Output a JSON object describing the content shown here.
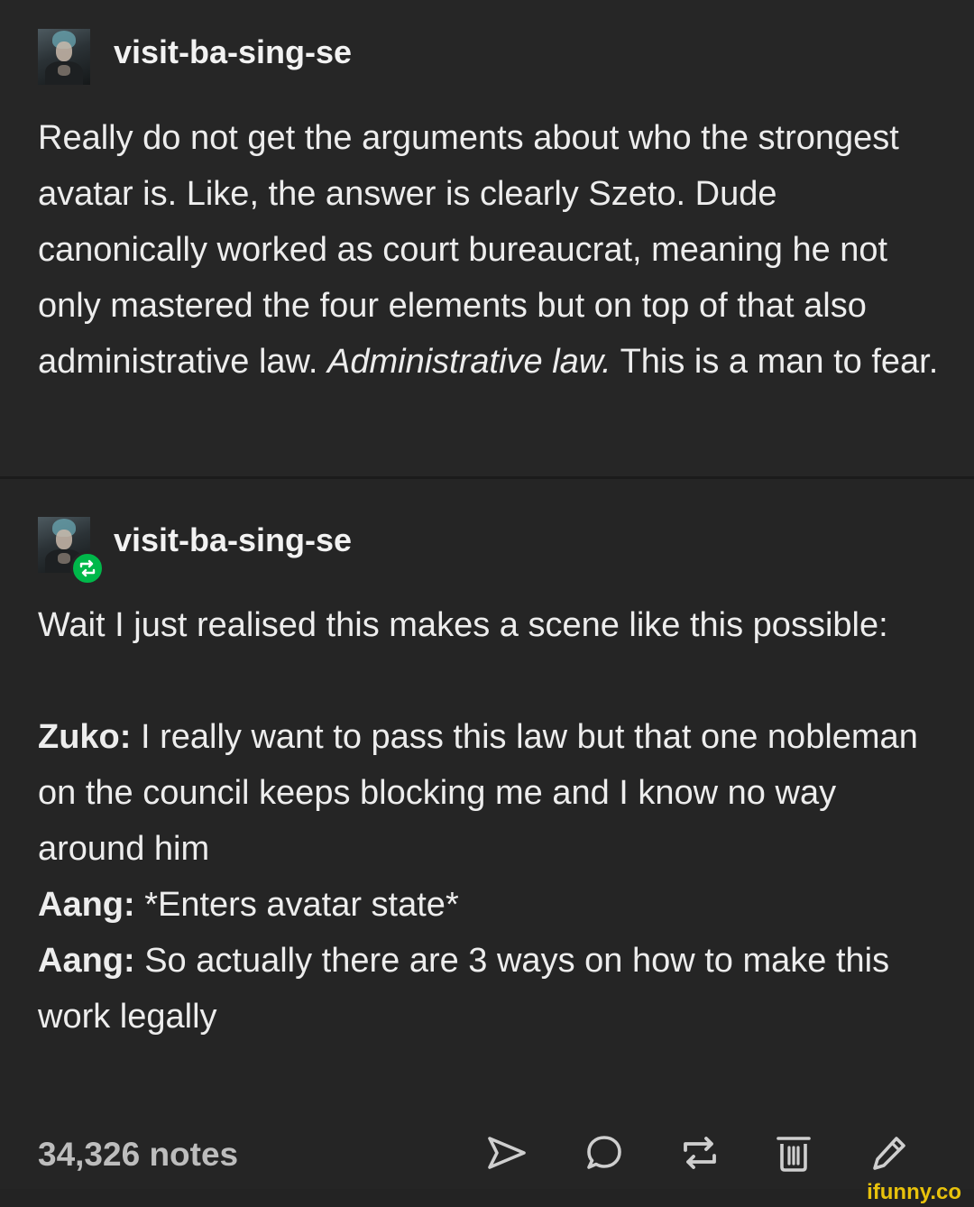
{
  "posts": [
    {
      "username": "visit-ba-sing-se",
      "avatar_icon": "user-avatar-icon",
      "paragraphs": [
        "Really do not get the arguments about who the strongest avatar is. Like, the answer is clearly Szeto. Dude canonically worked as court bureaucrat, meaning he not only mastered the four elements but on top of that also administrative law."
      ],
      "emphasis": "Administrative law.",
      "closing": " This is a man to fear."
    },
    {
      "username": "visit-ba-sing-se",
      "avatar_icon": "user-avatar-icon",
      "badge_icon": "reblog-icon",
      "intro": "Wait I just realised this makes a scene like this possible:",
      "dialogue": [
        {
          "speaker": "Zuko:",
          "line": " I really want to pass this law but that one nobleman on the council keeps blocking me and I know no way around him"
        },
        {
          "speaker": "Aang:",
          "line": " *Enters avatar state*"
        },
        {
          "speaker": "Aang:",
          "line": " So actually there are 3 ways on how to make this work legally"
        }
      ]
    }
  ],
  "footer": {
    "notes": "34,326 notes",
    "actions": [
      {
        "name": "share",
        "icon": "send-icon"
      },
      {
        "name": "reply",
        "icon": "comment-icon"
      },
      {
        "name": "reblog",
        "icon": "reblog-icon"
      },
      {
        "name": "delete",
        "icon": "trash-icon"
      },
      {
        "name": "edit",
        "icon": "pencil-icon"
      }
    ]
  },
  "watermark": "ifunny.co",
  "colors": {
    "background": "#252525",
    "text": "#ededed",
    "notes": "#bdbdbd",
    "reblog_badge": "#00b84a",
    "watermark": "#e8c20c"
  }
}
